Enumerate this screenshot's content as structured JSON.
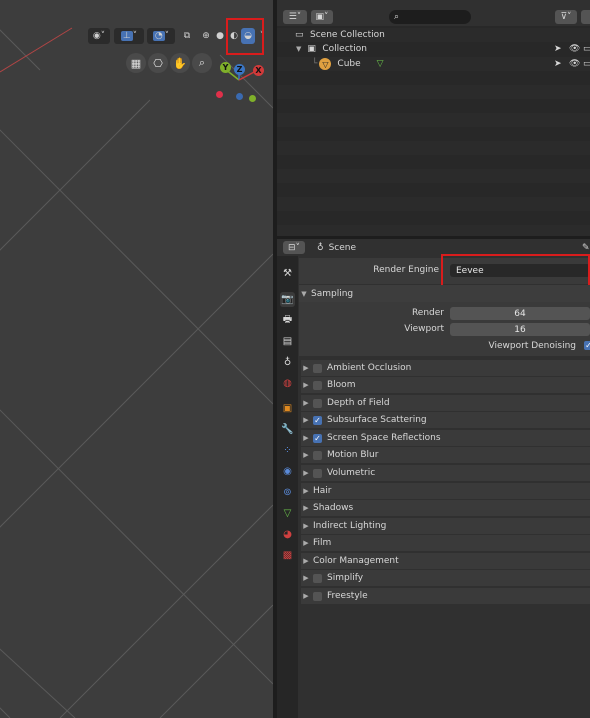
{
  "viewport": {
    "gizmo": {
      "y_label": "Y",
      "z_label": "Z",
      "x_label": "X"
    },
    "icons": [
      "visibility-icon",
      "transform-orientation-icon",
      "overlay-icon",
      "xray-icon",
      "wireframe-shading-icon",
      "solid-shading-icon",
      "material-preview-icon",
      "rendered-shading-icon",
      "grid-view-icon",
      "camera-icon",
      "hand-pan-icon",
      "zoom-icon"
    ]
  },
  "outliner": {
    "search_placeholder": "",
    "rows": [
      {
        "label": "Scene Collection"
      },
      {
        "label": "Collection"
      },
      {
        "label": "Cube"
      }
    ]
  },
  "properties": {
    "header_title": "Scene",
    "render_engine_label": "Render Engine",
    "render_engine_value": "Eevee",
    "sampling": {
      "title": "Sampling",
      "render_label": "Render",
      "render_value": "64",
      "viewport_label": "Viewport",
      "viewport_value": "16",
      "denoise_label": "Viewport Denoising"
    },
    "panels": [
      {
        "label": "Ambient Occlusion",
        "checkbox": true,
        "checked": false
      },
      {
        "label": "Bloom",
        "checkbox": true,
        "checked": false
      },
      {
        "label": "Depth of Field",
        "checkbox": true,
        "checked": false
      },
      {
        "label": "Subsurface Scattering",
        "checkbox": true,
        "checked": true
      },
      {
        "label": "Screen Space Reflections",
        "checkbox": true,
        "checked": true
      },
      {
        "label": "Motion Blur",
        "checkbox": true,
        "checked": false
      },
      {
        "label": "Volumetric",
        "checkbox": true,
        "checked": false
      },
      {
        "label": "Hair",
        "checkbox": false,
        "checked": false
      },
      {
        "label": "Shadows",
        "checkbox": false,
        "checked": false
      },
      {
        "label": "Indirect Lighting",
        "checkbox": false,
        "checked": false
      },
      {
        "label": "Film",
        "checkbox": false,
        "checked": false
      },
      {
        "label": "Color Management",
        "checkbox": false,
        "checked": false
      },
      {
        "label": "Simplify",
        "checkbox": true,
        "checked": false
      },
      {
        "label": "Freestyle",
        "checkbox": true,
        "checked": false
      }
    ]
  },
  "colors": {
    "highlight_red": "#d91c1c",
    "accent_blue": "#4772b3"
  }
}
